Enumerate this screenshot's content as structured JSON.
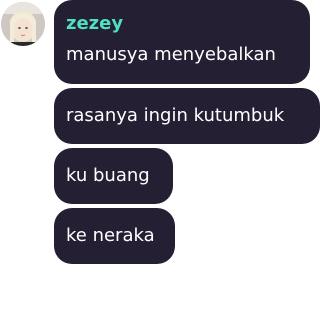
{
  "chat": {
    "username": "zezey",
    "username_color": "#4fe0bf",
    "bubble_color": "#241f33",
    "avatar_icon": "user-avatar",
    "messages": [
      "manusya menyebalkan",
      "rasanya ingin kutumbuk",
      "ku buang",
      "ke neraka"
    ]
  }
}
